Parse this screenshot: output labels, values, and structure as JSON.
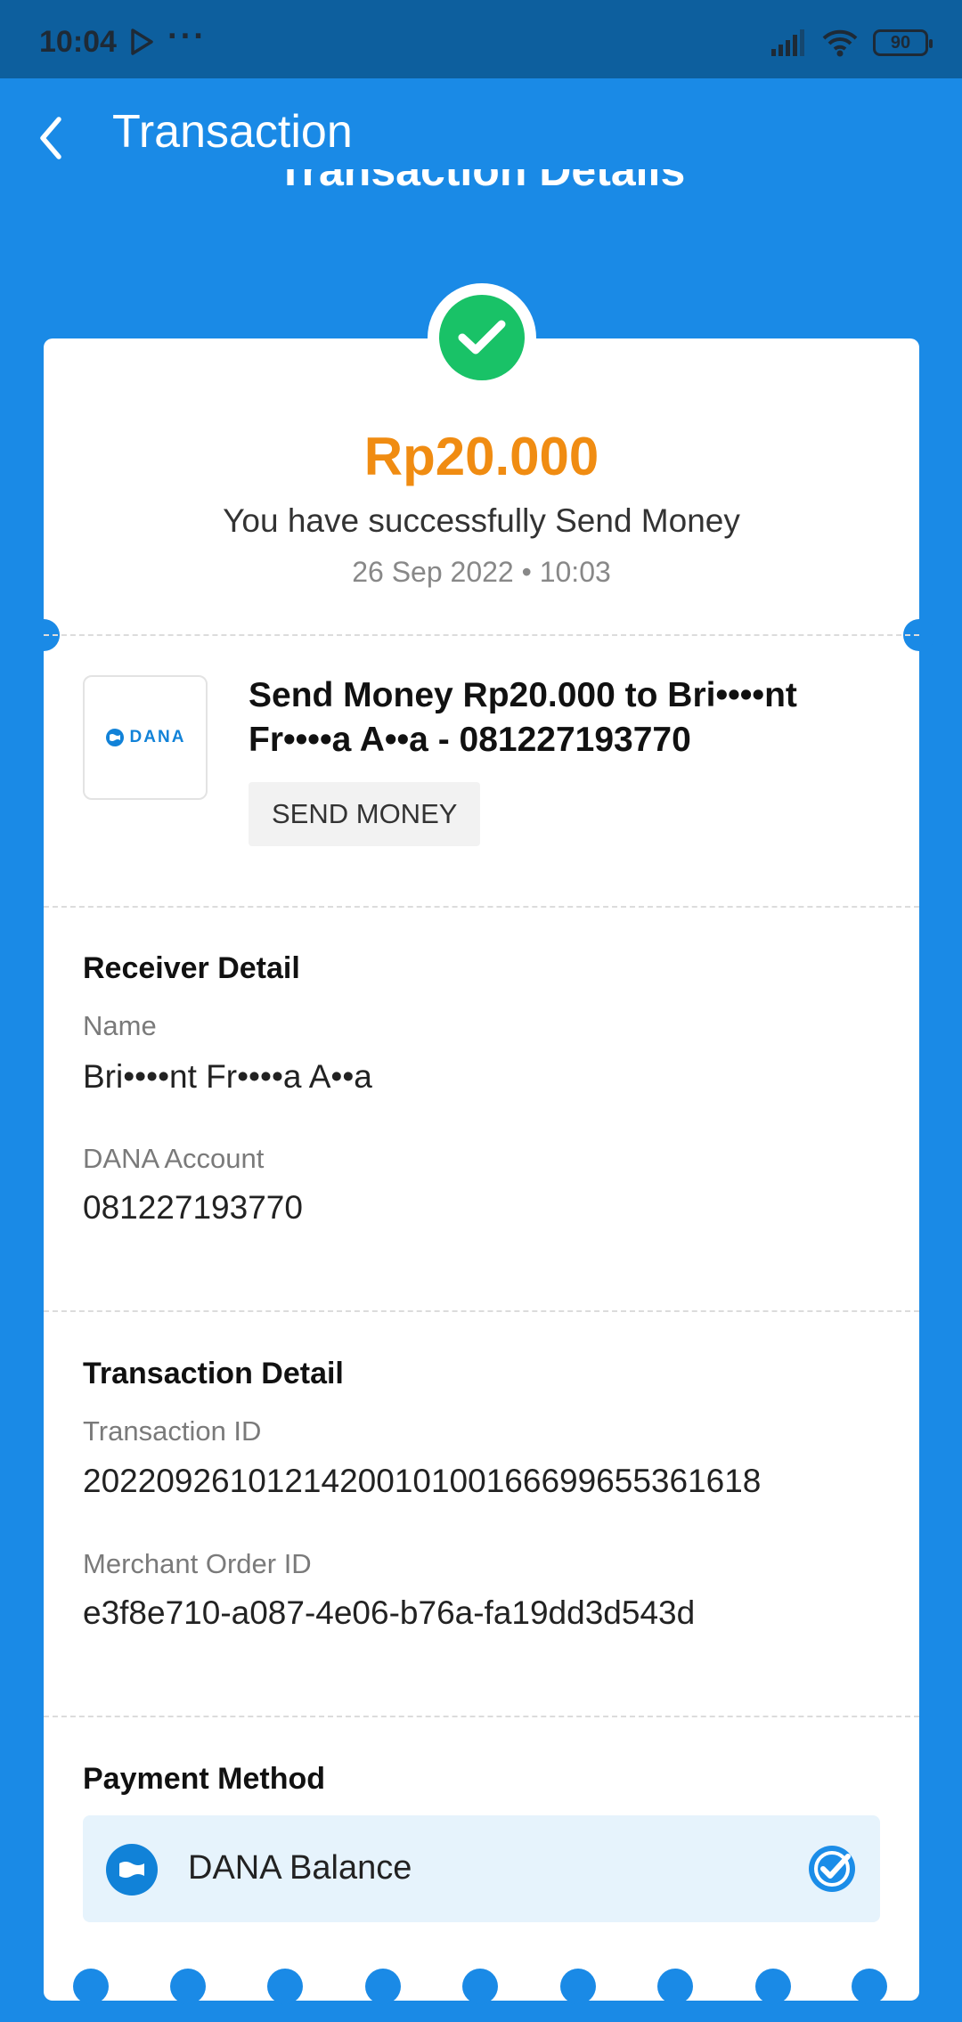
{
  "status_bar": {
    "time": "10:04",
    "dots": "···",
    "battery": "90"
  },
  "app_bar": {
    "title": "Transaction",
    "back_icon": "chevron-left-icon"
  },
  "page": {
    "ghost_title": "Transaction Details"
  },
  "summary": {
    "amount": "Rp20.000",
    "message": "You have successfully Send Money",
    "datetime": "26 Sep 2022 • 10:03",
    "status_icon": "check-circle-icon"
  },
  "merchant": {
    "logo_text": "DANA",
    "title": "Send Money Rp20.000 to Bri••••nt Fr••••a A••a - 081227193770",
    "tag": "SEND MONEY"
  },
  "receiver_detail": {
    "heading": "Receiver Detail",
    "name_label": "Name",
    "name_value": "Bri••••nt Fr••••a A••a",
    "account_label": "DANA Account",
    "account_value": "081227193770"
  },
  "transaction_detail": {
    "heading": "Transaction Detail",
    "id_label": "Transaction ID",
    "id_value": "2022092610121420010100166699655361618",
    "order_label": "Merchant Order ID",
    "order_value": "e3f8e710-a087-4e06-b76a-fa19dd3d543d"
  },
  "payment_method": {
    "heading": "Payment Method",
    "method": "DANA Balance",
    "selected": true
  },
  "colors": {
    "brand_blue": "#1a8ae6",
    "status_bar": "#0d5f9e",
    "amount_orange": "#f08c12",
    "success_green": "#19c267"
  }
}
